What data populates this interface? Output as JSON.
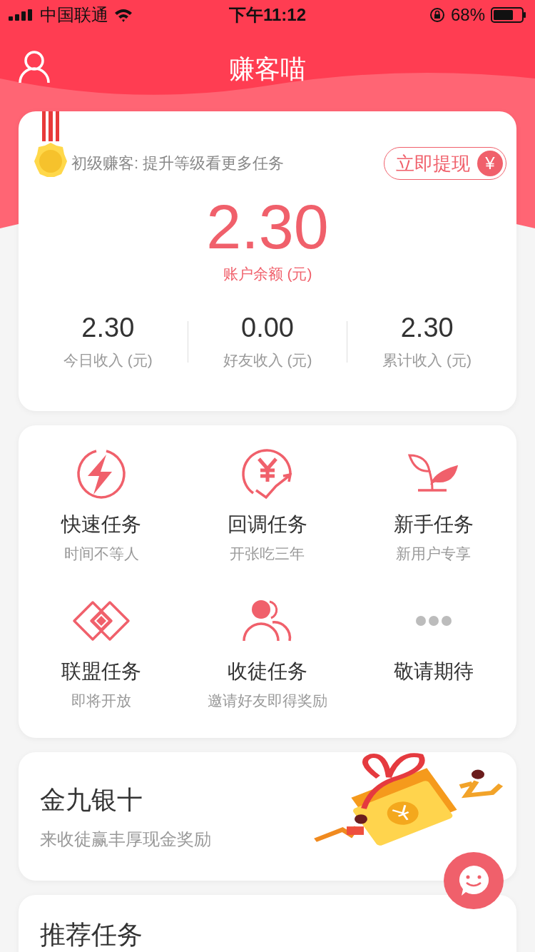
{
  "status_bar": {
    "carrier": "中国联通",
    "time": "下午11:12",
    "battery": "68%"
  },
  "header": {
    "title": "赚客喵"
  },
  "account": {
    "level_text": "初级赚客:  提升等级看更多任务",
    "withdraw": {
      "label": "立即提现",
      "badge": "¥"
    },
    "balance": "2.30",
    "balance_label": "账户余额 (元)",
    "stats": [
      {
        "value": "2.30",
        "label": "今日收入 (元)"
      },
      {
        "value": "0.00",
        "label": "好友收入 (元)"
      },
      {
        "value": "2.30",
        "label": "累计收入 (元)"
      }
    ]
  },
  "tasks": [
    {
      "kind": "bolt",
      "title": "快速任务",
      "subtitle": "时间不等人"
    },
    {
      "kind": "yuan",
      "title": "回调任务",
      "subtitle": "开张吃三年"
    },
    {
      "kind": "sprout",
      "title": "新手任务",
      "subtitle": "新用户专享"
    },
    {
      "kind": "diamond",
      "title": "联盟任务",
      "subtitle": "即将开放"
    },
    {
      "kind": "people",
      "title": "收徒任务",
      "subtitle": "邀请好友即得奖励"
    },
    {
      "kind": "more",
      "title": "敬请期待"
    }
  ],
  "promo": {
    "title": "金九银十",
    "subtitle": "来收徒赢丰厚现金奖励"
  },
  "recommended": {
    "title": "推荐任务"
  }
}
